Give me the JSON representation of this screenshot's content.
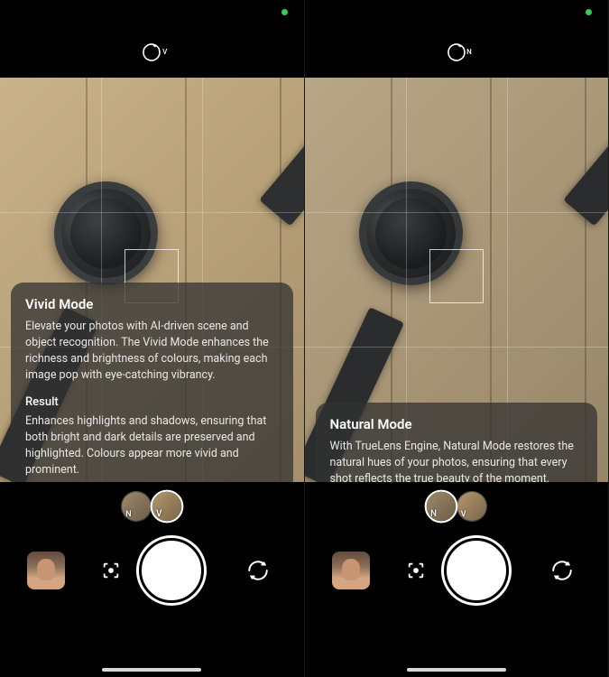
{
  "left": {
    "mode_indicator": "V",
    "thumbs": {
      "n": "N",
      "v": "V",
      "active": "V"
    },
    "card": {
      "title": "Vivid Mode",
      "body": "Elevate your photos with AI-driven scene and object recognition. The Vivid Mode enhances the richness and brightness of colours, making each image pop with eye-catching vibrancy.",
      "subtitle": "Result",
      "body2": "Enhances highlights and shadows,  ensuring that both bright and dark details are preserved and highlighted.  Colours appear more vivid and prominent."
    }
  },
  "right": {
    "mode_indicator": "N",
    "thumbs": {
      "n": "N",
      "v": "V",
      "active": "N"
    },
    "card": {
      "title": "Natural Mode",
      "body": "With TrueLens Engine, Natural Mode restores the natural hues of your photos, ensuring that every shot reflects the true beauty of the moment."
    }
  }
}
